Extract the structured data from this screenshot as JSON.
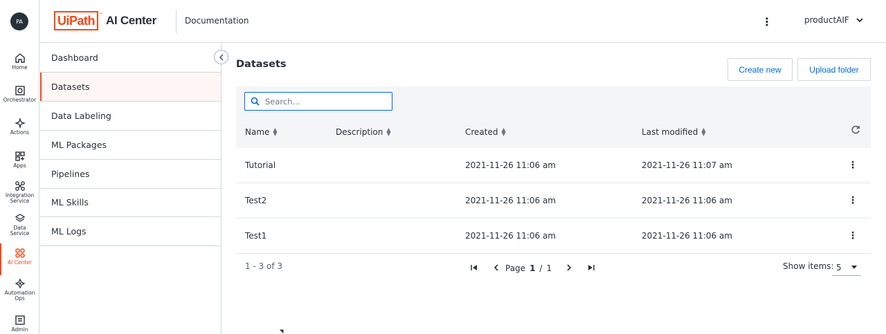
{
  "user": {
    "initials": "PA"
  },
  "rail": [
    {
      "label": "Home",
      "icon": "home-icon"
    },
    {
      "label": "Orchestrator",
      "icon": "orchestrator-icon"
    },
    {
      "label": "Actions",
      "icon": "actions-icon"
    },
    {
      "label": "Apps",
      "icon": "apps-icon"
    },
    {
      "label": "Integration\nService",
      "icon": "integration-service-icon"
    },
    {
      "label": "Data\nService",
      "icon": "data-service-icon"
    },
    {
      "label": "AI Center",
      "icon": "ai-center-icon",
      "active": true
    },
    {
      "label": "Automation\nOps",
      "icon": "automation-ops-icon"
    },
    {
      "label": "Admin",
      "icon": "admin-icon"
    }
  ],
  "header": {
    "logo_box": "UiPath",
    "logo_tm": "™",
    "logo_text": "AI Center",
    "doc_link": "Documentation",
    "tenant": "productAIF"
  },
  "subnav": {
    "items": [
      "Dashboard",
      "Datasets",
      "Data Labeling",
      "ML Packages",
      "Pipelines",
      "ML Skills",
      "ML Logs"
    ],
    "active_index": 1
  },
  "main": {
    "title": "Datasets",
    "create_label": "Create new",
    "upload_label": "Upload folder",
    "search_placeholder": "Search...",
    "columns": [
      "Name",
      "Description",
      "Created",
      "Last modified"
    ],
    "rows": [
      {
        "name": "Tutorial",
        "description": "",
        "created": "2021-11-26 11:06 am",
        "modified": "2021-11-26 11:07 am"
      },
      {
        "name": "Test2",
        "description": "",
        "created": "2021-11-26 11:06 am",
        "modified": "2021-11-26 11:06 am"
      },
      {
        "name": "Test1",
        "description": "",
        "created": "2021-11-26 11:06 am",
        "modified": "2021-11-26 11:06 am"
      }
    ],
    "range": "1 - 3 of 3",
    "page_label": "Page",
    "page_current": "1",
    "page_sep": "/",
    "page_total": "1",
    "show_items_label": "Show items:",
    "show_items_value": "5"
  },
  "colors": {
    "accent": "#fa4616",
    "link": "#0067df"
  }
}
